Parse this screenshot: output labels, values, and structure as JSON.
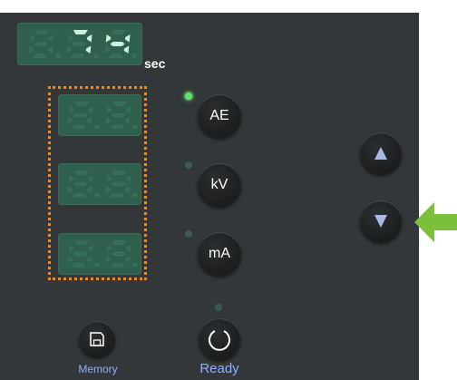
{
  "time_display": {
    "digits": [
      "8",
      "7",
      "4"
    ],
    "lit": [
      false,
      true,
      true
    ],
    "decimal_after": 1
  },
  "time_unit": "sec",
  "value_displays": [
    {
      "digits": [
        "8",
        "8"
      ],
      "lit": [
        false,
        false
      ]
    },
    {
      "digits": [
        "8",
        "8"
      ],
      "lit": [
        false,
        false
      ]
    },
    {
      "digits": [
        "8",
        "8"
      ],
      "lit": [
        false,
        false
      ]
    }
  ],
  "mode_buttons": [
    {
      "label": "AE",
      "led_on": true
    },
    {
      "label": "kV",
      "led_on": false
    },
    {
      "label": "mA",
      "led_on": false
    }
  ],
  "memory_button": {
    "label": "Memory",
    "icon": "floppy-disk-icon"
  },
  "ready_button": {
    "label": "Ready",
    "icon": "power-ring-icon",
    "led_on": false
  },
  "up_button": {
    "icon": "triangle-up-icon"
  },
  "down_button": {
    "icon": "triangle-down-icon"
  },
  "pointer": {
    "icon": "arrow-left-icon",
    "color": "#7cbf3a"
  },
  "colors": {
    "panel": "#333739",
    "led_on": "#5fe06a",
    "highlight": "#f08a1a",
    "caption": "#8fb0ff",
    "arrow_buttons": "#a9b8e6"
  }
}
